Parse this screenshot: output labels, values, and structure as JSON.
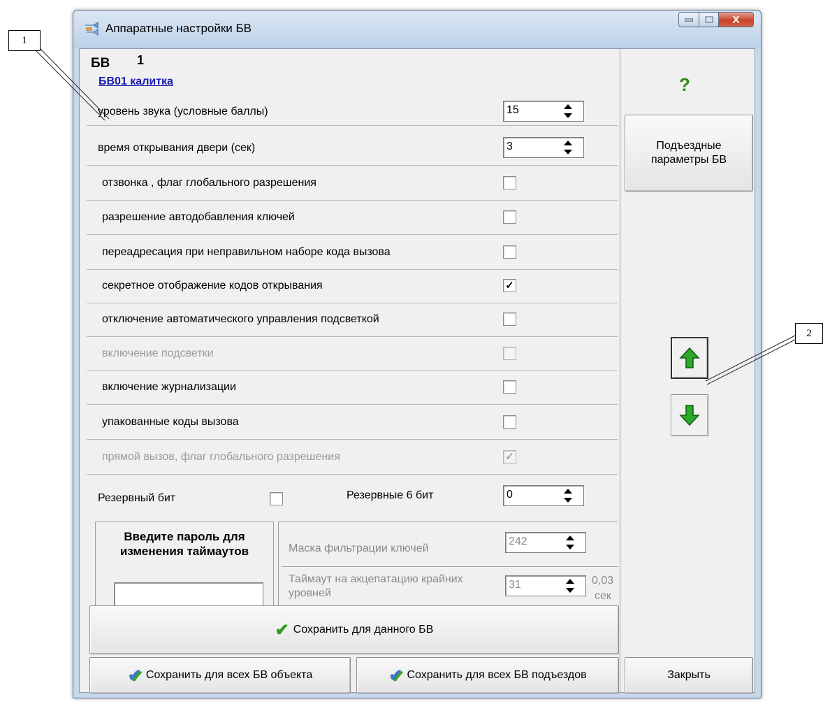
{
  "callouts": [
    "1",
    "2"
  ],
  "window": {
    "title": "Аппаратные настройки БВ",
    "close_label": "X"
  },
  "bv": {
    "label": "БВ",
    "number": "1",
    "name": "БВ01 калитка"
  },
  "settings": [
    {
      "label": "уровень звука (условные баллы)",
      "type": "spin",
      "value": "15",
      "disabled": false
    },
    {
      "label": "время открывания двери (сек)",
      "type": "spin",
      "value": "3",
      "disabled": false
    },
    {
      "label": "отзвонка , флаг глобального разрешения",
      "type": "check",
      "checked": false,
      "disabled": false
    },
    {
      "label": "разрешение автодобавления ключей",
      "type": "check",
      "checked": false,
      "disabled": false
    },
    {
      "label": "переадресация при неправильном наборе кода вызова",
      "type": "check",
      "checked": false,
      "disabled": false
    },
    {
      "label": "секретное отображение кодов открывания",
      "type": "check",
      "checked": true,
      "disabled": false
    },
    {
      "label": "отключение автоматического управления подсветкой",
      "type": "check",
      "checked": false,
      "disabled": false
    },
    {
      "label": "включение подсветки",
      "type": "check",
      "checked": false,
      "disabled": true
    },
    {
      "label": "включение журнализации",
      "type": "check",
      "checked": false,
      "disabled": false
    },
    {
      "label": "упакованные коды вызова",
      "type": "check",
      "checked": false,
      "disabled": false
    },
    {
      "label": "прямой вызов, флаг глобального разрешения",
      "type": "check",
      "checked": true,
      "disabled": true
    }
  ],
  "reserve": {
    "bit_label": "Резервный бит",
    "bit_checked": false,
    "bits6_label": "Резервные 6 бит",
    "bits6_value": "0"
  },
  "password": {
    "title": "Введите пароль для изменения таймаутов",
    "value": ""
  },
  "timeouts": {
    "mask_label": "Маска фильтрации ключей",
    "mask_value": "242",
    "accept_label": "Таймаут на акцепатацию крайних уровней",
    "accept_value": "31",
    "unit_value": "0,03",
    "unit_label": "сек"
  },
  "buttons": {
    "save_this": "Сохранить для данного БВ",
    "save_object": "Сохранить для всех БВ объекта",
    "save_entrances": "Сохранить для всех БВ подъездов",
    "entrance_params": "Подъездные параметры БВ",
    "close": "Закрыть",
    "help": "?"
  },
  "colors": {
    "accent_green": "#2f9b1f",
    "link_blue": "#1a1ab0",
    "disabled_text": "#9a9a9a"
  }
}
